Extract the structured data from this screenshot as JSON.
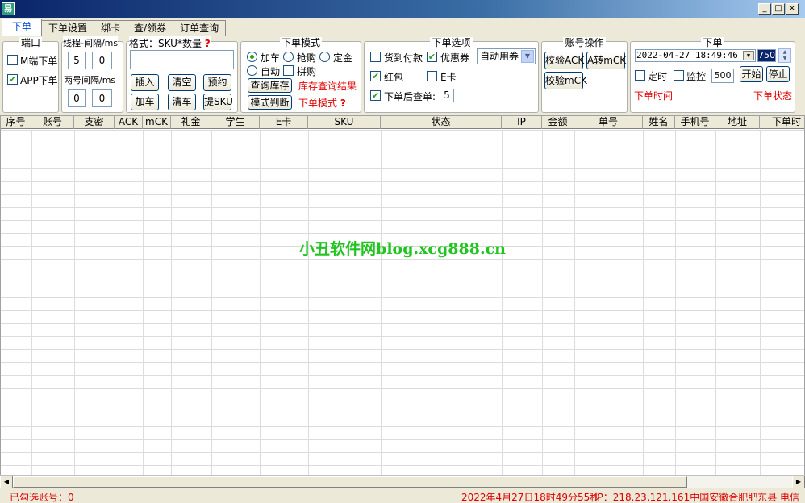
{
  "window": {
    "app_icon": "易",
    "minimize": "_",
    "maximize": "□",
    "close": "×"
  },
  "tabs": [
    "下单",
    "下单设置",
    "绑卡",
    "查/领券",
    "订单查询"
  ],
  "port": {
    "title": "端口",
    "m_order": "M端下单",
    "app_order": "APP下单",
    "m_checked": false,
    "app_checked": true
  },
  "thread": {
    "title": "线程-间隔/ms",
    "threads": "5",
    "interval": "0",
    "two_label": "两号间隔/ms",
    "two_a": "0",
    "two_b": "0"
  },
  "sku": {
    "format_label": "格式：SKU*数量",
    "value": "",
    "insert": "插入",
    "clear": "清空",
    "reserve": "预约",
    "add_cart": "加车",
    "clear_cart": "清车",
    "extract": "提SKU"
  },
  "mode": {
    "title": "下单模式",
    "add": "加车",
    "rush": "抢购",
    "deposit": "定金",
    "auto": "自动",
    "group": "拼购",
    "check_stock": "查询库存",
    "stock_result": "库存查询结果",
    "judge": "模式判断",
    "mode_label": "下单模式"
  },
  "options": {
    "title": "下单选项",
    "cod": "货到付款",
    "coupon": "优惠券",
    "coupon_select": "自动用券",
    "redpack": "红包",
    "ecard": "E卡",
    "check_after": "下单后查单:",
    "check_after_value": "5"
  },
  "account": {
    "title": "账号操作",
    "verify_ack": "校验ACK",
    "a_to_mck": "A转mCK",
    "verify_mck": "校验mCK"
  },
  "order": {
    "title": "下单",
    "datetime": "2022-04-27 18:49:46",
    "ms": "750",
    "timed": "定时",
    "monitor": "监控",
    "monitor_value": "500",
    "start": "开始",
    "stop": "停止",
    "time_label": "下单时间",
    "state_label": "下单状态"
  },
  "grid": {
    "columns": [
      "序号",
      "账号",
      "支密",
      "ACK",
      "mCK",
      "礼金",
      "学生",
      "E卡",
      "SKU",
      "状态",
      "IP",
      "金额",
      "单号",
      "姓名",
      "手机号",
      "地址",
      "下单时"
    ]
  },
  "watermark": "小丑软件网blog.xcg888.cn",
  "status": {
    "selected": "已勾选账号：0",
    "datetime": "2022年4月27日18时49分55秒",
    "ip": "IP：218.23.121.161中国安徽合肥肥东县 电信"
  },
  "colors": {
    "accent_red": "#e00000",
    "check_green": "#21a121",
    "watermark_green": "#22c422",
    "tab_active_blue": "#0046d5"
  }
}
